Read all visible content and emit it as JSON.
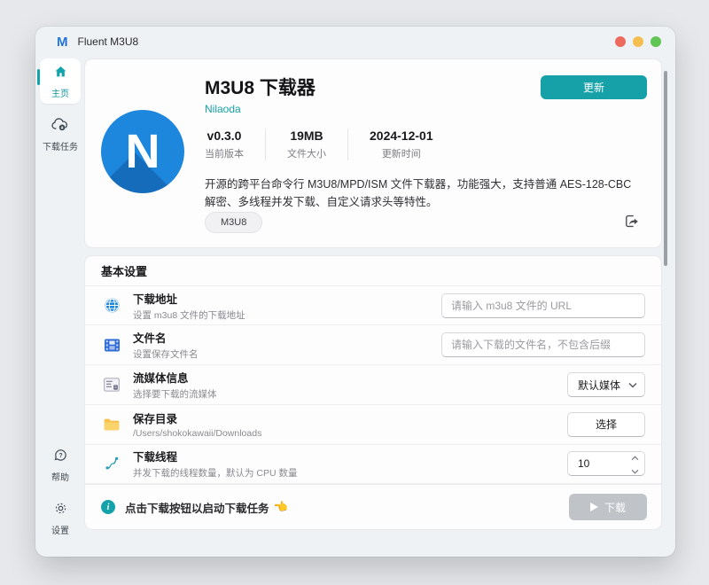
{
  "window": {
    "app_title": "Fluent M3U8"
  },
  "sidebar": {
    "home": {
      "label": "主页"
    },
    "tasks": {
      "label": "下载任务"
    },
    "help": {
      "label": "帮助"
    },
    "settings": {
      "label": "设置"
    }
  },
  "hero": {
    "title": "M3U8 下载器",
    "author": "Nilaoda",
    "update_button": "更新",
    "icon_letter": "N",
    "stats": [
      {
        "value": "v0.3.0",
        "label": "当前版本"
      },
      {
        "value": "19MB",
        "label": "文件大小"
      },
      {
        "value": "2024-12-01",
        "label": "更新时间"
      }
    ],
    "description": "开源的跨平台命令行 M3U8/MPD/ISM 文件下载器，功能强大，支持普通 AES-128-CBC 解密、多线程并发下载、自定义请求头等特性。",
    "tag": "M3U8"
  },
  "settings_panel": {
    "section_title": "基本设置",
    "rows": [
      {
        "icon": "globe-icon",
        "title": "下载地址",
        "subtitle": "设置 m3u8 文件的下载地址",
        "placeholder": "请输入 m3u8 文件的 URL"
      },
      {
        "icon": "film-icon",
        "title": "文件名",
        "subtitle": "设置保存文件名",
        "placeholder": "请输入下载的文件名，不包含后缀"
      },
      {
        "icon": "media-info-icon",
        "title": "流媒体信息",
        "subtitle": "选择要下载的流媒体",
        "value": "默认媒体"
      },
      {
        "icon": "folder-icon",
        "title": "保存目录",
        "subtitle": "/Users/shokokawaii/Downloads",
        "value": "选择"
      },
      {
        "icon": "threads-icon",
        "title": "下载线程",
        "subtitle": "并发下载的线程数量，默认为 CPU 数量",
        "value": "10"
      }
    ]
  },
  "footer": {
    "hint": "点击下载按钮以启动下载任务",
    "pointer_emoji": "👈",
    "download_button": "下载"
  },
  "colors": {
    "accent_teal": "#16a1a9",
    "icon_blue": "#1d86dd",
    "disabled_gray": "#c0c4c8"
  }
}
